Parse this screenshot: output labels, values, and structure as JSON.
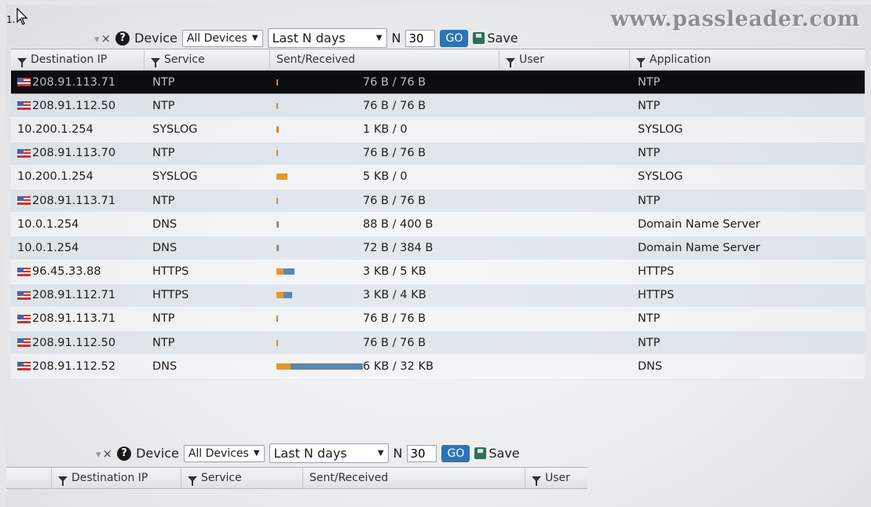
{
  "page_label": "1.",
  "watermark": "www.passleader.com",
  "toolbar": {
    "device_label": "Device",
    "device_value": "All Devices",
    "range_value": "Last N days",
    "n_label": "N",
    "n_value": "30",
    "go_label": "GO",
    "save_label": "Save",
    "clear_label": "×"
  },
  "columns": {
    "destination_ip": "Destination IP",
    "service": "Service",
    "sent_received": "Sent/Received",
    "user": "User",
    "application": "Application"
  },
  "rows": [
    {
      "flag": true,
      "ip": "208.91.113.71",
      "service": "NTP",
      "sent_received": "76 B / 76 B",
      "sent_frac": 0.0,
      "recv_frac": 0.0,
      "user": "",
      "application": "NTP"
    },
    {
      "flag": true,
      "ip": "208.91.112.50",
      "service": "NTP",
      "sent_received": "76 B / 76 B",
      "sent_frac": 0.0,
      "recv_frac": 0.0,
      "user": "",
      "application": "NTP"
    },
    {
      "flag": false,
      "ip": "10.200.1.254",
      "service": "SYSLOG",
      "sent_received": "1 KB / 0",
      "sent_frac": 0.03,
      "recv_frac": 0.0,
      "user": "",
      "application": "SYSLOG"
    },
    {
      "flag": true,
      "ip": "208.91.113.70",
      "service": "NTP",
      "sent_received": "76 B / 76 B",
      "sent_frac": 0.0,
      "recv_frac": 0.0,
      "user": "",
      "application": "NTP"
    },
    {
      "flag": false,
      "ip": "10.200.1.254",
      "service": "SYSLOG",
      "sent_received": "5 KB / 0",
      "sent_frac": 0.13,
      "recv_frac": 0.0,
      "user": "",
      "application": "SYSLOG"
    },
    {
      "flag": true,
      "ip": "208.91.113.71",
      "service": "NTP",
      "sent_received": "76 B / 76 B",
      "sent_frac": 0.0,
      "recv_frac": 0.0,
      "user": "",
      "application": "NTP"
    },
    {
      "flag": false,
      "ip": "10.0.1.254",
      "service": "DNS",
      "sent_received": "88 B / 400 B",
      "sent_frac": 0.0,
      "recv_frac": 0.01,
      "user": "",
      "application": "Domain Name Server"
    },
    {
      "flag": false,
      "ip": "10.0.1.254",
      "service": "DNS",
      "sent_received": "72 B / 384 B",
      "sent_frac": 0.0,
      "recv_frac": 0.01,
      "user": "",
      "application": "Domain Name Server"
    },
    {
      "flag": true,
      "ip": "96.45.33.88",
      "service": "HTTPS",
      "sent_received": "3 KB / 5 KB",
      "sent_frac": 0.08,
      "recv_frac": 0.13,
      "user": "",
      "application": "HTTPS"
    },
    {
      "flag": true,
      "ip": "208.91.112.71",
      "service": "HTTPS",
      "sent_received": "3 KB / 4 KB",
      "sent_frac": 0.08,
      "recv_frac": 0.1,
      "user": "",
      "application": "HTTPS"
    },
    {
      "flag": true,
      "ip": "208.91.113.71",
      "service": "NTP",
      "sent_received": "76 B / 76 B",
      "sent_frac": 0.0,
      "recv_frac": 0.0,
      "user": "",
      "application": "NTP"
    },
    {
      "flag": true,
      "ip": "208.91.112.50",
      "service": "NTP",
      "sent_received": "76 B / 76 B",
      "sent_frac": 0.0,
      "recv_frac": 0.0,
      "user": "",
      "application": "NTP"
    },
    {
      "flag": true,
      "ip": "208.91.112.52",
      "service": "DNS",
      "sent_received": "6 KB / 32 KB",
      "sent_frac": 0.16,
      "recv_frac": 0.84,
      "user": "",
      "application": "DNS"
    }
  ],
  "colors": {
    "sent": "#e09a2c",
    "received": "#5f87a8",
    "selected_row": "#0d0d0f",
    "go_button": "#2b74b8"
  },
  "icons": [
    "pointer-cursor-icon",
    "help-icon",
    "funnel-icon",
    "us-flag-icon",
    "save-icon",
    "dropdown-caret-icon"
  ]
}
